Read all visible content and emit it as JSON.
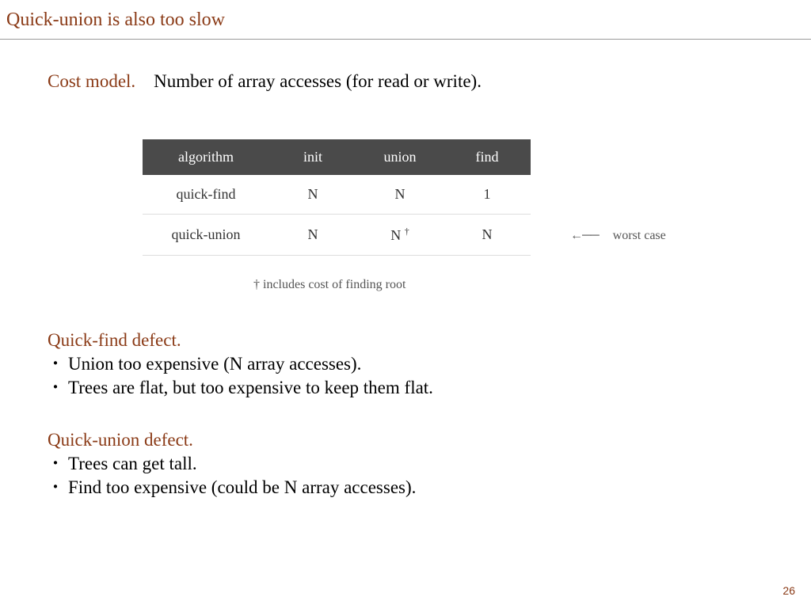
{
  "title": "Quick-union is also too slow",
  "cost_model": {
    "label": "Cost model.",
    "desc": "Number of array accesses (for read or write)."
  },
  "table": {
    "headers": {
      "c0": "algorithm",
      "c1": "init",
      "c2": "union",
      "c3": "find"
    },
    "rows": [
      {
        "c0": "quick-find",
        "c1": "N",
        "c2": "N",
        "c3": "1"
      },
      {
        "c0": "quick-union",
        "c1": "N",
        "c2": "N ",
        "c3": "N"
      }
    ],
    "dagger": "†"
  },
  "annotation": {
    "arrow": "←──",
    "text": "worst case"
  },
  "footnote": "† includes cost of finding root",
  "qf_defect": {
    "heading": "Quick-find defect.",
    "b1": "Union too expensive (N array accesses).",
    "b2": "Trees are flat, but too expensive to keep them flat."
  },
  "qu_defect": {
    "heading": "Quick-union defect.",
    "b1": "Trees can get tall.",
    "b2": "Find too expensive (could be N array accesses)."
  },
  "page_number": "26"
}
